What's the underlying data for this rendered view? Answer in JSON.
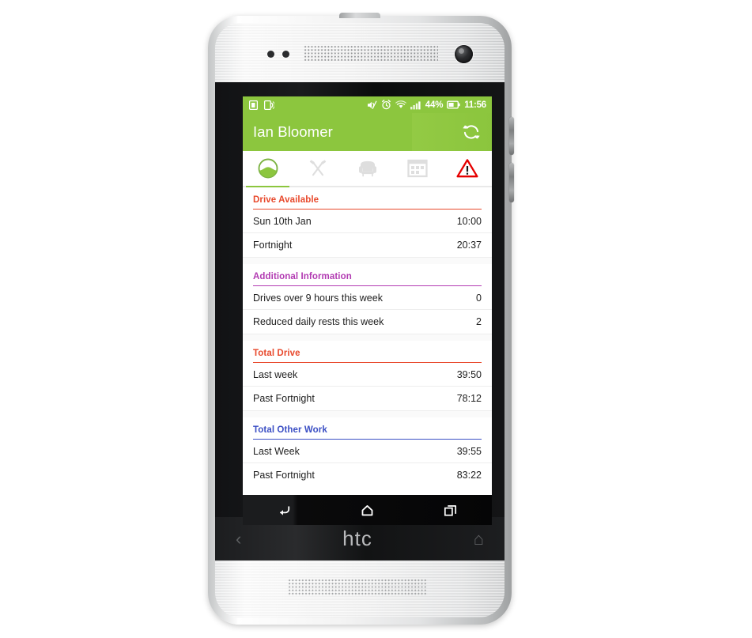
{
  "device": {
    "brand": "htc",
    "back_nav_icon": "chevron-left-icon",
    "home_nav_icon": "home-outline-icon"
  },
  "status_bar": {
    "left_icons": [
      "sd-card-icon",
      "vibrate-phone-icon"
    ],
    "right_icons": [
      "sound-mute-icon",
      "alarm-clock-icon",
      "wifi-icon",
      "signal-bars-icon"
    ],
    "battery_percent": "44%",
    "battery_icon": "battery-icon",
    "time": "11:56",
    "background_color": "#8cc63e"
  },
  "app_bar": {
    "title": "Ian Bloomer",
    "sync_icon": "refresh-sync-icon",
    "background_color": "#8cc63e"
  },
  "tabs": [
    {
      "name": "drive",
      "icon": "steering-wheel-icon",
      "active": true
    },
    {
      "name": "work",
      "icon": "crossed-hammers-icon",
      "active": false
    },
    {
      "name": "rest",
      "icon": "armchair-icon",
      "active": false
    },
    {
      "name": "calendar",
      "icon": "calendar-icon",
      "active": false
    },
    {
      "name": "warnings",
      "icon": "warning-triangle-icon",
      "active": false
    }
  ],
  "sections": [
    {
      "title": "Drive Available",
      "color": "#e8492c",
      "rows": [
        {
          "label": "Sun 10th Jan",
          "value": "10:00"
        },
        {
          "label": "Fortnight",
          "value": "20:37"
        }
      ]
    },
    {
      "title": "Additional Information",
      "color": "#b23bb2",
      "rows": [
        {
          "label": "Drives over 9 hours this week",
          "value": "0"
        },
        {
          "label": "Reduced daily rests this week",
          "value": "2"
        }
      ]
    },
    {
      "title": "Total Drive",
      "color": "#e8492c",
      "rows": [
        {
          "label": "Last week",
          "value": "39:50"
        },
        {
          "label": "Past Fortnight",
          "value": "78:12"
        }
      ]
    },
    {
      "title": "Total Other Work",
      "color": "#3b4fc4",
      "rows": [
        {
          "label": "Last Week",
          "value": "39:55"
        },
        {
          "label": "Past Fortnight",
          "value": "83:22"
        }
      ]
    }
  ],
  "system_nav": {
    "back_icon": "back-arrow-icon",
    "home_icon": "home-icon",
    "recents_icon": "recent-apps-icon"
  }
}
